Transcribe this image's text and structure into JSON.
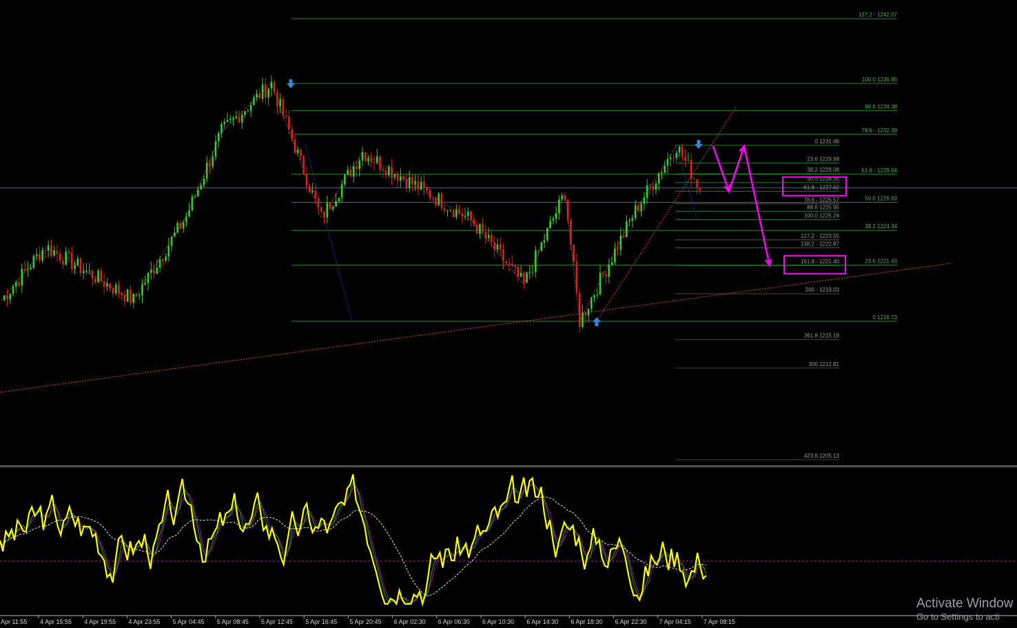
{
  "chart_data": {
    "type": "candlestick",
    "instrument_note": "",
    "price_range": [
      1204.5,
      1243.5
    ],
    "colors": {
      "bull": "#2fd12f",
      "bear": "#e32020",
      "fib": "#2a8a2a",
      "fib_text": "#5fa85f",
      "indicator_main": "#ffff00",
      "indicator_signal1": "#19a519",
      "indicator_signal2": "#b000b0",
      "trend": "#e05020",
      "arrow_marker": "#2b8ad8",
      "forecast": "#ff00ff"
    },
    "time_axis": [
      "Apr 11:55",
      "4 Apr 15:55",
      "4 Apr 19:55",
      "4 Apr 23:55",
      "5 Apr 04:45",
      "5 Apr 08:45",
      "5 Apr 12:45",
      "5 Apr 16:45",
      "5 Apr 20:45",
      "6 Apr 02:30",
      "6 Apr 06:30",
      "6 Apr 10:30",
      "6 Apr 14:30",
      "6 Apr 18:30",
      "6 Apr 22:30",
      "7 Apr 04:15",
      "7 Apr 08:15"
    ],
    "current_price": 1227.9,
    "swing_path": [
      {
        "bar": 0,
        "price": 1218.5
      },
      {
        "bar": 15,
        "price": 1223.0
      },
      {
        "bar": 45,
        "price": 1218.5
      },
      {
        "bar": 63,
        "price": 1225.5
      },
      {
        "bar": 75,
        "price": 1232.6
      },
      {
        "bar": 92,
        "price": 1236.65
      },
      {
        "bar": 109,
        "price": 1225.4
      },
      {
        "bar": 123,
        "price": 1230.9
      },
      {
        "bar": 160,
        "price": 1225.2
      },
      {
        "bar": 178,
        "price": 1219.8
      },
      {
        "bar": 192,
        "price": 1227.5
      },
      {
        "bar": 197,
        "price": 1216.73
      },
      {
        "bar": 216,
        "price": 1226.0
      },
      {
        "bar": 230,
        "price": 1231.46
      }
    ],
    "fib_sets": [
      {
        "name": "",
        "levels": [
          {
            "label": "127.2 - 1242.07",
            "price": 1242.07
          },
          {
            "label": "100.0 1236.65",
            "price": 1236.65
          },
          {
            "label": "88.6 1234.38",
            "price": 1234.38
          },
          {
            "label": "78.6 - 1232.39",
            "price": 1232.39
          },
          {
            "label": "61.8 - 1229.04",
            "price": 1229.04
          },
          {
            "label": "50.0 1226.69",
            "price": 1226.69
          },
          {
            "label": "38.2 1224.34",
            "price": 1224.34
          },
          {
            "label": "23.6 1221.43",
            "price": 1221.43
          },
          {
            "label": "0 1216.73",
            "price": 1216.73
          }
        ]
      },
      {
        "name": "",
        "levels": [
          {
            "label": "0 1231.46",
            "price": 1231.46
          },
          {
            "label": "23.6 1229.99",
            "price": 1229.99
          },
          {
            "label": "38.2 1229.08",
            "price": 1229.08
          },
          {
            "label": "50.0 1228.35",
            "price": 1228.35
          },
          {
            "label": "61.8 - 1227.62",
            "price": 1227.62
          },
          {
            "label": "78.6 - 1226.57",
            "price": 1226.57
          },
          {
            "label": "88.6 1225.95",
            "price": 1225.95
          },
          {
            "label": "100.0 1225.24",
            "price": 1225.24
          },
          {
            "label": "127.2 - 1223.55",
            "price": 1223.55
          },
          {
            "label": "138.2 - 1222.87",
            "price": 1222.87
          },
          {
            "label": "161.8 - 1221.40",
            "price": 1221.4
          },
          {
            "label": "200 - 1219.03",
            "price": 1219.03
          },
          {
            "label": "261.8 1215.19",
            "price": 1215.19
          },
          {
            "label": "300 1212.81",
            "price": 1212.81
          },
          {
            "label": "423.6 1205.13",
            "price": 1205.13
          }
        ]
      }
    ],
    "highlighted_levels": [
      "50.0 1228.35 / 61.8 - 1227.62",
      "161.8 - 1221.40"
    ],
    "forecast_path": [
      {
        "bar": 234,
        "price": 1231.4
      },
      {
        "bar": 240,
        "price": 1227.6
      },
      {
        "bar": 246,
        "price": 1231.4
      },
      {
        "bar": 256,
        "price": 1221.4
      }
    ],
    "indicator": {
      "type": "oscillator",
      "range": [
        0,
        100
      ],
      "reference_level": 35
    }
  },
  "watermark": {
    "line1": "Activate Window",
    "line2": "Go to Settings to acti"
  }
}
